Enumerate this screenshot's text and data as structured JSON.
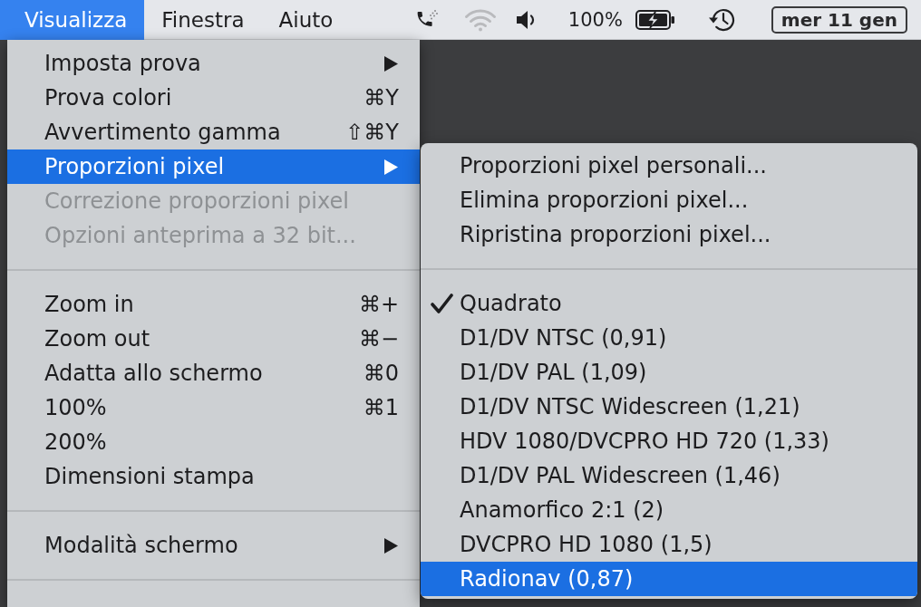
{
  "menu_bar": {
    "menus": [
      {
        "label": "Visualizza",
        "selected": true
      },
      {
        "label": "Finestra",
        "selected": false
      },
      {
        "label": "Aiuto",
        "selected": false
      }
    ],
    "battery": "100%",
    "date": "mer 11 gen"
  },
  "menu": {
    "groups": [
      {
        "items": [
          {
            "label": "Imposta prova",
            "submenu": true,
            "disabled": false,
            "selected": false
          },
          {
            "label": "Prova colori",
            "shortcut": "⌘Y",
            "submenu": false,
            "disabled": false,
            "selected": false
          },
          {
            "label": "Avvertimento gamma",
            "shortcut": "⇧⌘Y",
            "submenu": false,
            "disabled": false,
            "selected": false
          },
          {
            "label": "Proporzioni pixel",
            "submenu": true,
            "disabled": false,
            "selected": true
          },
          {
            "label": "Correzione proporzioni pixel",
            "submenu": false,
            "disabled": true,
            "selected": false
          },
          {
            "label": "Opzioni anteprima a 32 bit...",
            "submenu": false,
            "disabled": true,
            "selected": false
          }
        ]
      },
      {
        "items": [
          {
            "label": "Zoom in",
            "shortcut": "⌘+",
            "submenu": false,
            "disabled": false,
            "selected": false
          },
          {
            "label": "Zoom out",
            "shortcut": "⌘−",
            "submenu": false,
            "disabled": false,
            "selected": false
          },
          {
            "label": "Adatta allo schermo",
            "shortcut": "⌘0",
            "submenu": false,
            "disabled": false,
            "selected": false
          },
          {
            "label": "100%",
            "shortcut": "⌘1",
            "submenu": false,
            "disabled": false,
            "selected": false
          },
          {
            "label": "200%",
            "submenu": false,
            "disabled": false,
            "selected": false
          },
          {
            "label": "Dimensioni stampa",
            "submenu": false,
            "disabled": false,
            "selected": false
          }
        ]
      },
      {
        "items": [
          {
            "label": "Modalità schermo",
            "submenu": true,
            "disabled": false,
            "selected": false
          }
        ]
      }
    ]
  },
  "submenu": {
    "groups": [
      {
        "items": [
          {
            "label": "Proporzioni pixel personali...",
            "checked": false,
            "selected": false
          },
          {
            "label": "Elimina proporzioni pixel...",
            "checked": false,
            "selected": false
          },
          {
            "label": "Ripristina proporzioni pixel...",
            "checked": false,
            "selected": false
          }
        ]
      },
      {
        "items": [
          {
            "label": "Quadrato",
            "checked": true,
            "selected": false
          },
          {
            "label": "D1/DV NTSC (0,91)",
            "checked": false,
            "selected": false
          },
          {
            "label": "D1/DV PAL (1,09)",
            "checked": false,
            "selected": false
          },
          {
            "label": "D1/DV NTSC Widescreen (1,21)",
            "checked": false,
            "selected": false
          },
          {
            "label": "HDV 1080/DVCPRO HD 720 (1,33)",
            "checked": false,
            "selected": false
          },
          {
            "label": "D1/DV PAL Widescreen (1,46)",
            "checked": false,
            "selected": false
          },
          {
            "label": "Anamorfico 2:1 (2)",
            "checked": false,
            "selected": false
          },
          {
            "label": "DVCPRO HD 1080 (1,5)",
            "checked": false,
            "selected": false
          },
          {
            "label": "Radionav (0,87)",
            "checked": false,
            "selected": true
          }
        ]
      }
    ]
  }
}
